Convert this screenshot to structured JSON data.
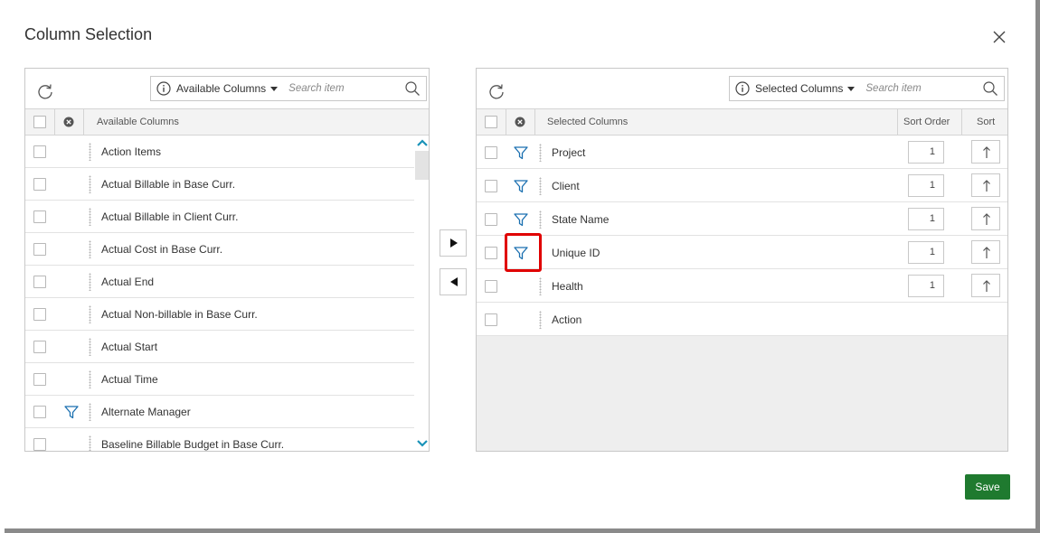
{
  "dialog": {
    "title": "Column Selection",
    "save_label": "Save"
  },
  "available": {
    "dropdown_label": "Available Columns",
    "search_placeholder": "Search item",
    "header_label": "Available Columns",
    "items": [
      {
        "label": "Action Items",
        "filter": false
      },
      {
        "label": "Actual Billable in Base Curr.",
        "filter": false
      },
      {
        "label": "Actual Billable in Client Curr.",
        "filter": false
      },
      {
        "label": "Actual Cost in Base Curr.",
        "filter": false
      },
      {
        "label": "Actual End",
        "filter": false
      },
      {
        "label": "Actual Non-billable in Base Curr.",
        "filter": false
      },
      {
        "label": "Actual Start",
        "filter": false
      },
      {
        "label": "Actual Time",
        "filter": false
      },
      {
        "label": "Alternate Manager",
        "filter": true
      },
      {
        "label": "Baseline Billable Budget in Base Curr.",
        "filter": false
      }
    ]
  },
  "selected": {
    "dropdown_label": "Selected Columns",
    "search_placeholder": "Search item",
    "header_label": "Selected Columns",
    "header_sort_order": "Sort Order",
    "header_sort": "Sort",
    "items": [
      {
        "label": "Project",
        "filter": true,
        "sort_order": "1",
        "sortable": true
      },
      {
        "label": "Client",
        "filter": true,
        "sort_order": "1",
        "sortable": true
      },
      {
        "label": "State Name",
        "filter": true,
        "sort_order": "1",
        "sortable": true
      },
      {
        "label": "Unique ID",
        "filter": true,
        "sort_order": "1",
        "sortable": true
      },
      {
        "label": "Health",
        "filter": false,
        "sort_order": "1",
        "sortable": true
      },
      {
        "label": "Action",
        "filter": false,
        "sort_order": null,
        "sortable": false
      }
    ]
  },
  "colors": {
    "accent_blue": "#1a6fb0",
    "save_green": "#1f7a2f",
    "highlight_red": "#e00000",
    "scroll_teal": "#1a93b8"
  },
  "icons": {
    "refresh": "refresh-icon",
    "info": "info-icon",
    "search": "search-icon",
    "filter": "filter-icon",
    "sort": "sort-ascending-icon",
    "close": "close-icon",
    "move_right": "move-right-icon",
    "move_left": "move-left-icon"
  }
}
